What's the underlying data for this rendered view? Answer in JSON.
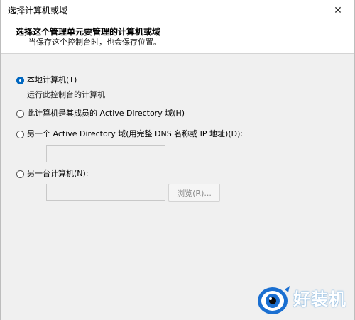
{
  "window": {
    "title": "选择计算机或域",
    "close_glyph": "✕"
  },
  "header": {
    "title": "选择这个管理单元要管理的计算机或域",
    "subtitle": "当保存这个控制台时，也会保存位置。"
  },
  "options": {
    "local": {
      "label": "本地计算机(T)",
      "checked": true
    },
    "local_desc": "运行此控制台的计算机",
    "ad_member": {
      "label": "此计算机是其成员的 Active Directory 域(H)",
      "checked": false
    },
    "another_ad": {
      "label": "另一个 Active Directory 域(用完整 DNS 名称或 IP 地址)(D):",
      "checked": false,
      "value": ""
    },
    "another_computer": {
      "label": "另一台计算机(N):",
      "checked": false,
      "value": ""
    }
  },
  "buttons": {
    "browse": "浏览(R)..."
  },
  "watermark": {
    "text": "好装机",
    "icon": "eye-logo-icon",
    "color": "#1a6fd1"
  },
  "colors": {
    "accent": "#0067c0"
  }
}
